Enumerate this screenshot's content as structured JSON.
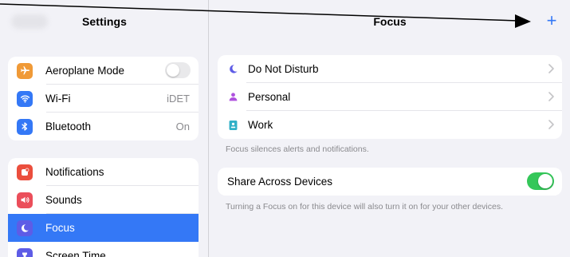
{
  "sidebar": {
    "title": "Settings",
    "group1": [
      {
        "label": "Aeroplane Mode",
        "icon": "airplane-icon",
        "color": "#f09a37",
        "control": "toggle",
        "toggle_on": false
      },
      {
        "label": "Wi-Fi",
        "icon": "wifi-icon",
        "color": "#3478f6",
        "value": "iDET"
      },
      {
        "label": "Bluetooth",
        "icon": "bluetooth-icon",
        "color": "#3478f6",
        "value": "On"
      }
    ],
    "group2": [
      {
        "label": "Notifications",
        "icon": "notifications-icon",
        "color": "#eb4e3d"
      },
      {
        "label": "Sounds",
        "icon": "speaker-icon",
        "color": "#eb4e5a"
      },
      {
        "label": "Focus",
        "icon": "moon-icon",
        "color": "#5e5ce6",
        "selected": true
      },
      {
        "label": "Screen Time",
        "icon": "hourglass-icon",
        "color": "#5e5ce6"
      }
    ]
  },
  "detail": {
    "title": "Focus",
    "add_label": "+",
    "focus_modes": [
      {
        "label": "Do Not Disturb",
        "icon": "moon-icon",
        "color": "#5e5ce6"
      },
      {
        "label": "Personal",
        "icon": "person-icon",
        "color": "#af52de"
      },
      {
        "label": "Work",
        "icon": "badge-icon",
        "color": "#30b0c7"
      }
    ],
    "focus_note": "Focus silences alerts and notifications.",
    "share": {
      "label": "Share Across Devices",
      "toggle_on": true,
      "note": "Turning a Focus on for this device will also turn it on for your other devices."
    }
  },
  "colors": {
    "accent": "#3478f6",
    "toggle_on": "#34c759",
    "background": "#f2f2f7",
    "annotation_arrow": "#000000"
  }
}
